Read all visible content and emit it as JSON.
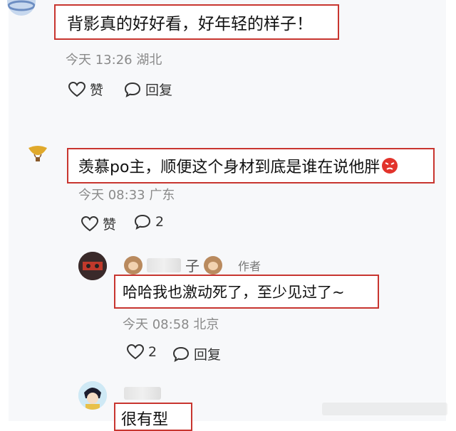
{
  "comments": [
    {
      "text": "背影真的好好看，好年轻的样子！",
      "meta": "今天 13:26 湖北",
      "like_label": "赞",
      "reply_label": "回复"
    },
    {
      "text": "羡慕po主，顺便这个身材到底是谁在说他胖",
      "meta": "今天 08:33 广东",
      "like_label": "赞",
      "reply_count": "2"
    }
  ],
  "replies": [
    {
      "name_suffix": "子",
      "author_badge": "作者",
      "text": "哈哈我也激动死了，至少见过了~",
      "meta": "今天 08:58 北京",
      "like_count": "2",
      "reply_label": "回复"
    },
    {
      "text": "很有型"
    }
  ],
  "colors": {
    "highlight_border": "#c8352f",
    "meta_text": "#8a8a8a",
    "panel_bg": "#f7f8fa"
  }
}
